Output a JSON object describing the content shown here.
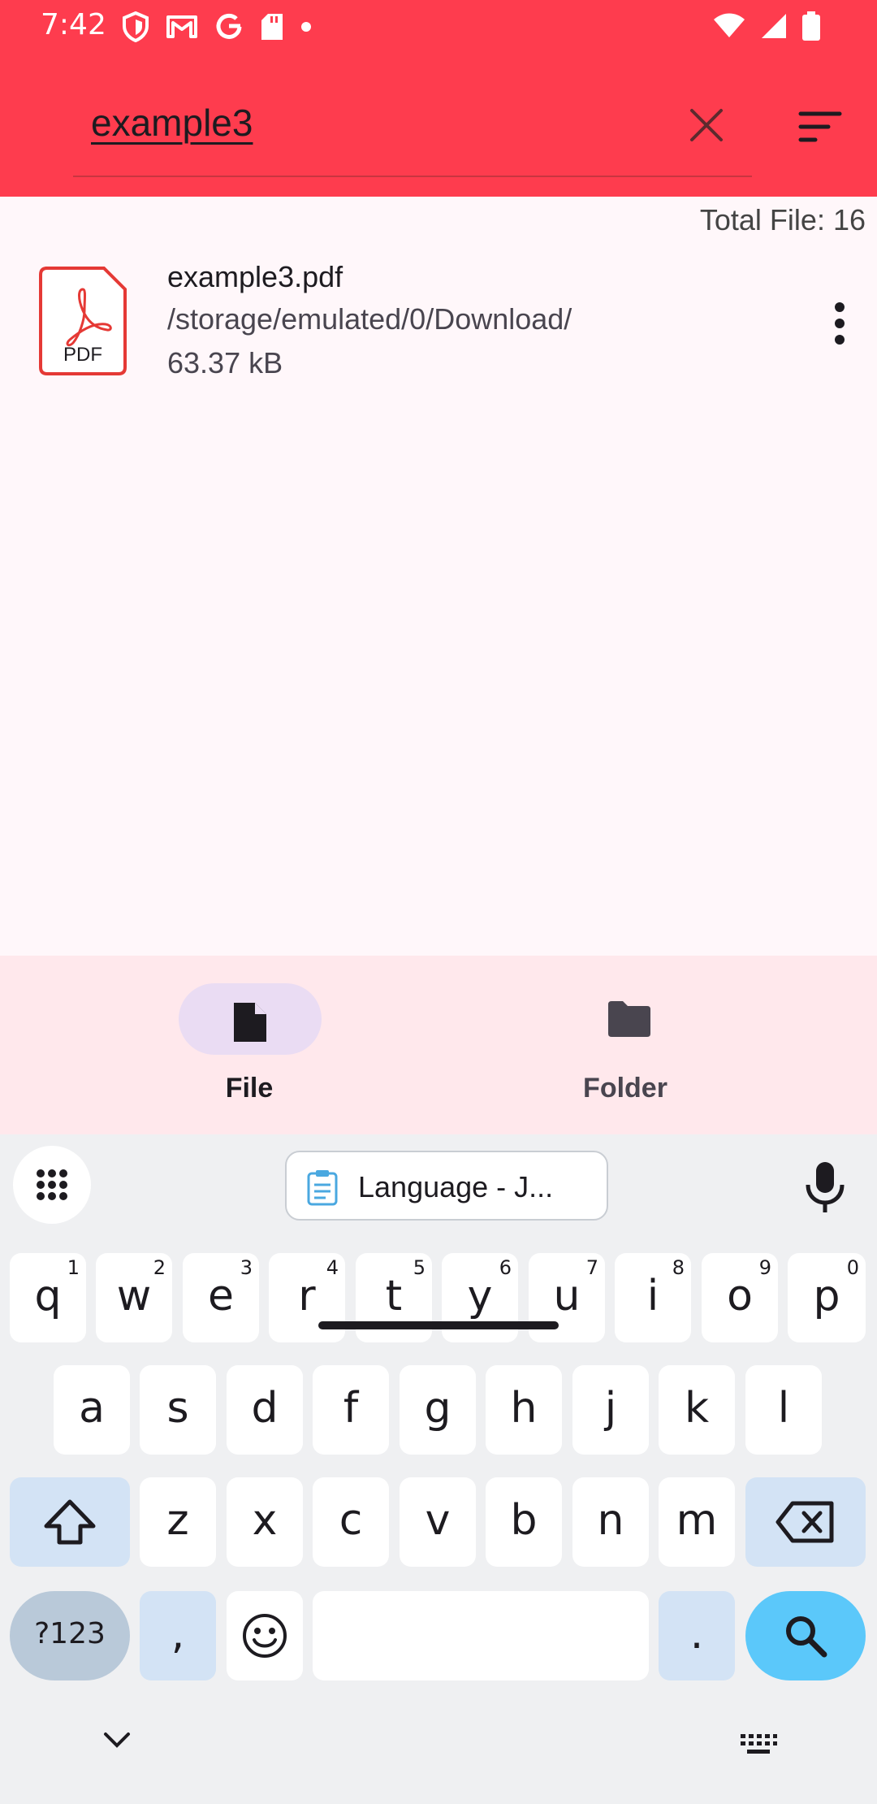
{
  "status_bar": {
    "time": "7:42",
    "icons": [
      "shield-icon",
      "gmail-icon",
      "google-icon",
      "sd-card-icon",
      "dot-icon",
      "wifi-icon",
      "signal-icon",
      "battery-icon"
    ]
  },
  "header": {
    "search_value": "example3",
    "accent_color": "#fe3c4e",
    "clear_icon": "close-icon",
    "sort_icon": "sort-icon"
  },
  "summary": {
    "total_label": "Total File: 16"
  },
  "files": [
    {
      "name": "example3.pdf",
      "path": "/storage/emulated/0/Download/",
      "size": "63.37 kB",
      "icon_label": "PDF"
    }
  ],
  "bottom_nav": {
    "items": [
      {
        "label": "File",
        "icon": "file-icon",
        "selected": true
      },
      {
        "label": "Folder",
        "icon": "folder-icon",
        "selected": false
      }
    ]
  },
  "keyboard": {
    "clipboard_chip": "Language - J...",
    "row1": [
      {
        "key": "q",
        "hint": "1"
      },
      {
        "key": "w",
        "hint": "2"
      },
      {
        "key": "e",
        "hint": "3"
      },
      {
        "key": "r",
        "hint": "4"
      },
      {
        "key": "t",
        "hint": "5"
      },
      {
        "key": "y",
        "hint": "6"
      },
      {
        "key": "u",
        "hint": "7"
      },
      {
        "key": "i",
        "hint": "8"
      },
      {
        "key": "o",
        "hint": "9"
      },
      {
        "key": "p",
        "hint": "0"
      }
    ],
    "row2": [
      "a",
      "s",
      "d",
      "f",
      "g",
      "h",
      "j",
      "k",
      "l"
    ],
    "row3": [
      "z",
      "x",
      "c",
      "v",
      "b",
      "n",
      "m"
    ],
    "sym_label": "?123",
    "comma": ",",
    "period": "."
  }
}
